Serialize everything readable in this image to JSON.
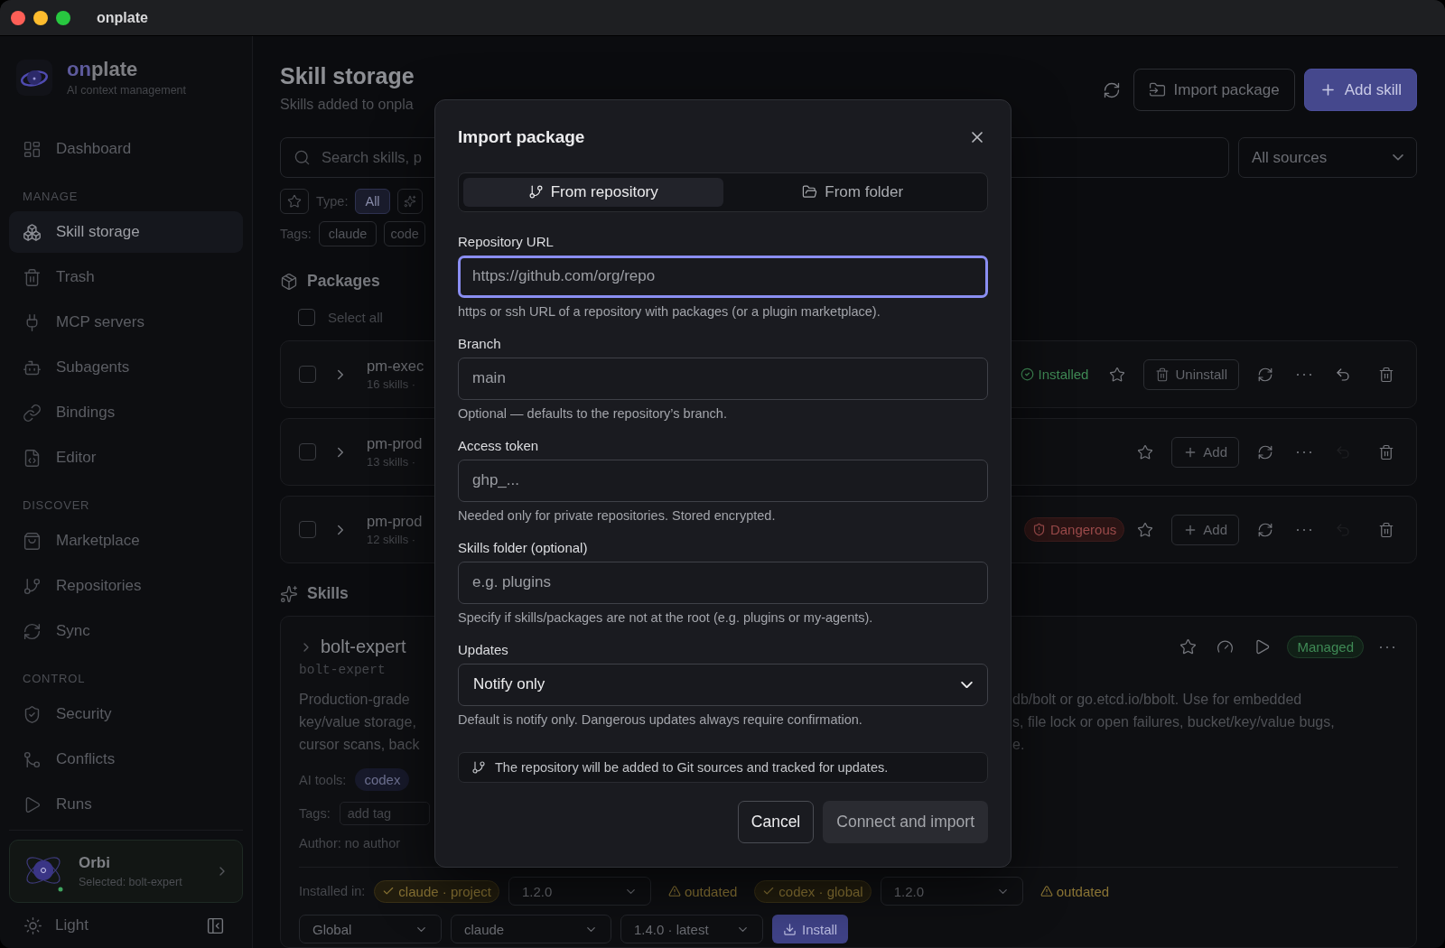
{
  "window": {
    "title": "onplate"
  },
  "sidebar": {
    "brand": {
      "highlight": "on",
      "rest": "plate",
      "tagline": "AI context management"
    },
    "sections": [
      {
        "items": [
          {
            "label": "Dashboard",
            "selected": false
          }
        ]
      },
      {
        "heading": "MANAGE",
        "items": [
          {
            "label": "Skill storage",
            "selected": true
          },
          {
            "label": "Trash",
            "selected": false
          },
          {
            "label": "MCP servers",
            "selected": false
          },
          {
            "label": "Subagents",
            "selected": false
          },
          {
            "label": "Bindings",
            "selected": false
          },
          {
            "label": "Editor",
            "selected": false
          }
        ]
      },
      {
        "heading": "DISCOVER",
        "items": [
          {
            "label": "Marketplace",
            "selected": false
          },
          {
            "label": "Repositories",
            "selected": false
          },
          {
            "label": "Sync",
            "selected": false
          }
        ]
      },
      {
        "heading": "CONTROL",
        "items": [
          {
            "label": "Security",
            "selected": false
          },
          {
            "label": "Conflicts",
            "selected": false
          },
          {
            "label": "Runs",
            "selected": false
          }
        ]
      }
    ],
    "assistant": {
      "name": "Orbi",
      "status": "Selected: bolt-expert"
    },
    "theme_toggle": "Light"
  },
  "header": {
    "title": "Skill storage",
    "subtitle": "Skills added to onpla",
    "buttons": [
      {
        "label": "Import package",
        "kind": "secondary"
      },
      {
        "label": "Add skill",
        "kind": "primary"
      }
    ]
  },
  "search": {
    "placeholder": "Search skills, p",
    "source": "All sources"
  },
  "filters": {
    "starred": false,
    "type_label": "Type:",
    "types": [
      {
        "label": "All",
        "selected": true
      },
      {
        "selected": false
      }
    ],
    "tags_label": "Tags:",
    "tags": [
      "claude",
      "code"
    ]
  },
  "packages": {
    "title": "Packages",
    "select_all": {
      "label": "Select all",
      "checked": false
    },
    "rows": [
      {
        "name": "pm-exec",
        "meta": "16 skills ·",
        "checked": false,
        "status": {
          "kind": "installed",
          "label": "Installed"
        },
        "action": {
          "kind": "uninstall",
          "label": "Uninstall"
        },
        "revert_disabled": false
      },
      {
        "name": "pm-prod",
        "meta": "13 skills ·",
        "checked": false,
        "action": {
          "kind": "add",
          "label": "Add"
        },
        "revert_disabled": true
      },
      {
        "name": "pm-prod",
        "meta": "12 skills ·",
        "checked": false,
        "status": {
          "kind": "dangerous",
          "label": "Dangerous"
        },
        "action": {
          "kind": "add",
          "label": "Add"
        },
        "revert_disabled": true
      }
    ]
  },
  "skills": {
    "title": "Skills",
    "card": {
      "name": "bolt-expert",
      "slug": "bolt-expert",
      "badge": "Managed",
      "description_left": [
        "Production-grade",
        "key/value storage,",
        "cursor scans, back"
      ],
      "description_right": [
        "db/bolt or go.etcd.io/bbolt. Use for embedded",
        "s, file lock or open failures, bucket/key/value bugs,",
        "e."
      ],
      "ai_tools_label": "AI tools:",
      "ai_tools": [
        "codex"
      ],
      "tags_label": "Tags:",
      "tag_placeholder": "add tag",
      "author": "Author: no author",
      "installed_label": "Installed in:",
      "installs": [
        {
          "target": "claude · project",
          "version": "1.2.0",
          "warning": "outdated"
        },
        {
          "target": "codex · global",
          "version": "1.2.0",
          "warning": "outdated"
        }
      ],
      "install_row": {
        "scope": "Global",
        "tool": "claude",
        "version": "1.4.0 · latest",
        "button": "Install"
      }
    }
  },
  "modal": {
    "title": "Import package",
    "tabs": [
      {
        "label": "From repository",
        "selected": true
      },
      {
        "label": "From folder",
        "selected": false
      }
    ],
    "fields": [
      {
        "kind": "text",
        "label": "Repository URL",
        "placeholder": "https://github.com/org/repo",
        "focused": true,
        "hint": "https or ssh URL of a repository with packages (or a plugin marketplace)."
      },
      {
        "kind": "text",
        "label": "Branch",
        "placeholder": "main",
        "focused": false,
        "hint": "Optional — defaults to the repository’s branch."
      },
      {
        "kind": "text",
        "label": "Access token",
        "placeholder": "ghp_...",
        "focused": false,
        "hint": "Needed only for private repositories. Stored encrypted."
      },
      {
        "kind": "text",
        "label": "Skills folder (optional)",
        "placeholder": "e.g. plugins",
        "focused": false,
        "hint": "Specify if skills/packages are not at the root (e.g. plugins or my-agents)."
      },
      {
        "kind": "select",
        "label": "Updates",
        "value": "Notify only",
        "focused": false,
        "hint": "Default is notify only. Dangerous updates always require confirmation."
      }
    ],
    "note": "The repository will be added to Git sources and tracked for updates.",
    "buttons": [
      {
        "label": "Cancel",
        "kind": "secondary"
      },
      {
        "label": "Connect and import",
        "kind": "primary",
        "disabled": true
      }
    ]
  }
}
